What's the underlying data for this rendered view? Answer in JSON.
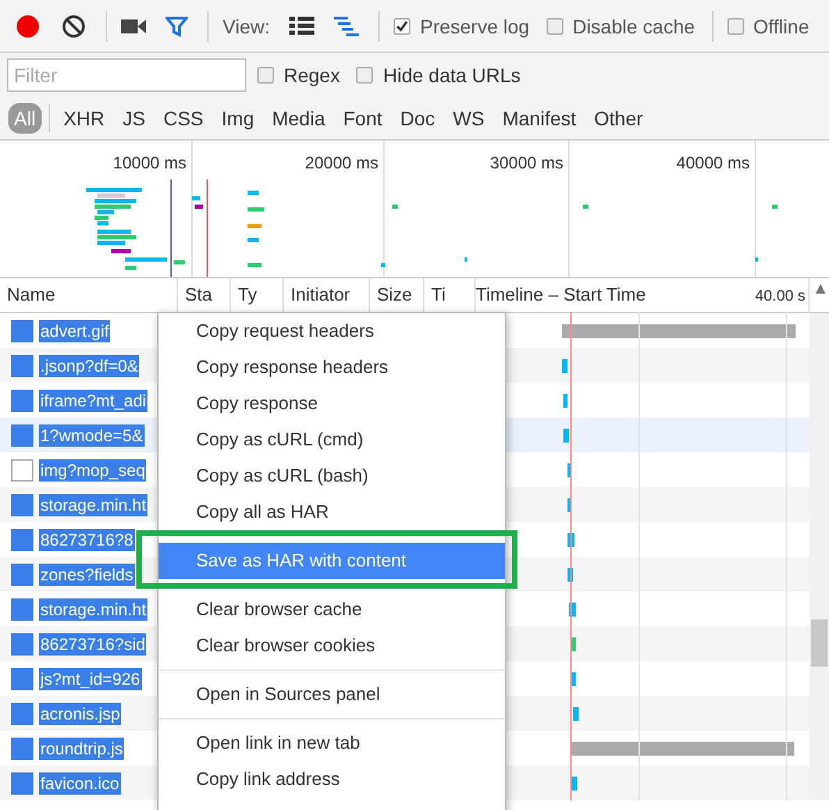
{
  "toolbar": {
    "recording": true,
    "filter_active": true,
    "view_label": "View:",
    "views": [
      {
        "kind": "list",
        "selected": false
      },
      {
        "kind": "waterfall",
        "selected": true
      }
    ],
    "checkboxes": [
      {
        "label": "Preserve log",
        "checked": true
      },
      {
        "label": "Disable cache",
        "checked": false
      },
      {
        "label": "Offline",
        "checked": false
      }
    ]
  },
  "filter_bar": {
    "placeholder": "Filter",
    "checkboxes": [
      {
        "label": "Regex",
        "checked": false
      },
      {
        "label": "Hide data URLs",
        "checked": false
      }
    ]
  },
  "type_filters": [
    {
      "label": "All",
      "selected": true
    },
    {
      "label": "XHR",
      "selected": false
    },
    {
      "label": "JS",
      "selected": false
    },
    {
      "label": "CSS",
      "selected": false
    },
    {
      "label": "Img",
      "selected": false
    },
    {
      "label": "Media",
      "selected": false
    },
    {
      "label": "Font",
      "selected": false
    },
    {
      "label": "Doc",
      "selected": false
    },
    {
      "label": "WS",
      "selected": false
    },
    {
      "label": "Manifest",
      "selected": false
    },
    {
      "label": "Other",
      "selected": false
    }
  ],
  "overview": {
    "ticks": [
      "10000 ms",
      "20000 ms",
      "30000 ms",
      "40000 ms"
    ]
  },
  "table": {
    "columns": [
      "Name",
      "Sta",
      "Ty",
      "Initiator",
      "Size",
      "Ti",
      "Timeline – Start Time"
    ],
    "timeline_scale": "40.00 s",
    "sort_arrow": "▲",
    "rows": [
      {
        "name": "advert.gif",
        "kind": "file",
        "selected": true,
        "hovered": false
      },
      {
        "name": ".jsonp?df=0&",
        "kind": "file",
        "selected": true,
        "hovered": false
      },
      {
        "name": "iframe?mt_adi",
        "kind": "file",
        "selected": true,
        "hovered": false
      },
      {
        "name": "1?wmode=5&",
        "kind": "file",
        "selected": true,
        "hovered": true
      },
      {
        "name": "img?mop_seq",
        "kind": "image",
        "selected": true,
        "hovered": false
      },
      {
        "name": "storage.min.ht",
        "kind": "file",
        "selected": true,
        "hovered": false
      },
      {
        "name": "86273716?8",
        "kind": "file",
        "selected": true,
        "hovered": false
      },
      {
        "name": "zones?fields",
        "kind": "file",
        "selected": true,
        "hovered": false
      },
      {
        "name": "storage.min.ht",
        "kind": "file",
        "selected": true,
        "hovered": false
      },
      {
        "name": "86273716?sid",
        "kind": "file",
        "selected": true,
        "hovered": false
      },
      {
        "name": "js?mt_id=926",
        "kind": "file",
        "selected": true,
        "hovered": false
      },
      {
        "name": "acronis.jsp",
        "kind": "file",
        "selected": true,
        "hovered": false
      },
      {
        "name": "roundtrip.js",
        "kind": "file",
        "selected": true,
        "hovered": false
      },
      {
        "name": "favicon.ico",
        "kind": "file",
        "selected": true,
        "hovered": false
      }
    ]
  },
  "context_menu": {
    "groups": [
      [
        {
          "label": "Copy request headers",
          "highlighted": false
        },
        {
          "label": "Copy response headers",
          "highlighted": false
        },
        {
          "label": "Copy response",
          "highlighted": false
        },
        {
          "label": "Copy as cURL (cmd)",
          "highlighted": false
        },
        {
          "label": "Copy as cURL (bash)",
          "highlighted": false
        },
        {
          "label": "Copy all as HAR",
          "highlighted": false
        }
      ],
      [
        {
          "label": "Save as HAR with content",
          "highlighted": true
        }
      ],
      [
        {
          "label": "Clear browser cache",
          "highlighted": false
        },
        {
          "label": "Clear browser cookies",
          "highlighted": false
        }
      ],
      [
        {
          "label": "Open in Sources panel",
          "highlighted": false
        }
      ],
      [
        {
          "label": "Open link in new tab",
          "highlighted": false
        },
        {
          "label": "Copy link address",
          "highlighted": false
        }
      ]
    ]
  }
}
